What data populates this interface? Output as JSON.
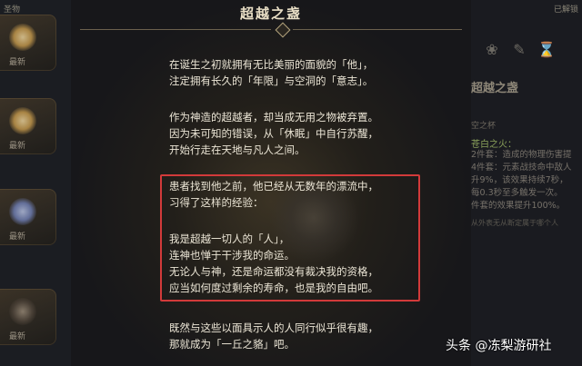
{
  "left_panel": {
    "header": "圣物",
    "slot_level": "最新"
  },
  "title": "超越之盏",
  "lore": {
    "p1": [
      "在诞生之初就拥有无比美丽的面貌的「他」，",
      "注定拥有长久的「年限」与空洞的「意志」。"
    ],
    "p2": [
      "作为神造的超越者，却当成无用之物被弃置。",
      "因为未可知的错误，从「休眠」中自行苏醒，",
      "开始行走在天地与凡人之间。"
    ],
    "p3": [
      "患者找到他之前，他已经从无数年的漂流中，",
      "习得了这样的经验："
    ],
    "p3b": [
      "我是超越一切人的「人」，",
      "连神也惮于干涉我的命运。",
      "无论人与神，还是命运都没有裁决我的资格，",
      "应当如何度过剩余的寿命，也是我的自由吧。"
    ],
    "p4": [
      "既然与这些以面具示人的人同行似乎很有趣，",
      "那就成为「一丘之貉」吧。"
    ]
  },
  "right_panel": {
    "header": "已解锁",
    "title": "超越之盏",
    "subtitle": "空之杯",
    "set_name": "苍白之火：",
    "lines": [
      "2件套：造成的物理伤害提",
      "4件套：元素战技命中敌人",
      "升9%，该效果持续7秒，",
      "每0.3秒至多触发一次。",
      "件套的效果提升100%。"
    ],
    "footer": "从外表无从断定属于哪个人"
  },
  "watermark": "头条 @冻梨游研社"
}
